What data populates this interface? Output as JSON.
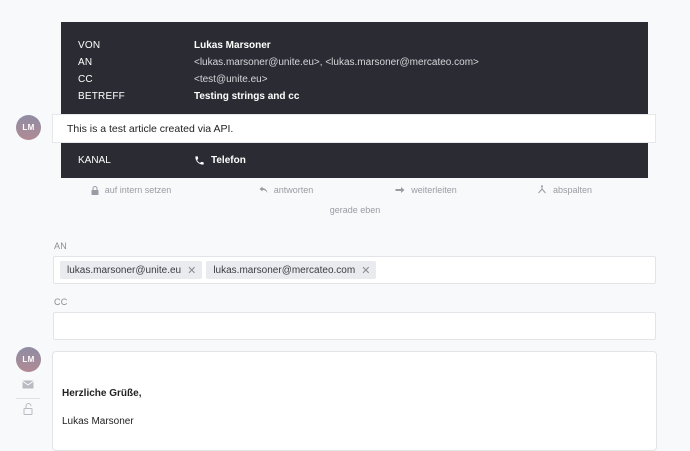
{
  "article": {
    "meta": [
      {
        "key": "VON",
        "value": "Lukas Marsoner",
        "strong": true
      },
      {
        "key": "AN",
        "value": "<lukas.marsoner@unite.eu>, <lukas.marsoner@mercateo.com>",
        "strong": false
      },
      {
        "key": "CC",
        "value": "<test@unite.eu>",
        "strong": false
      },
      {
        "key": "BETREFF",
        "value": "Testing strings and cc",
        "strong": true
      }
    ],
    "avatar_initials": "LM",
    "body": "This is a test article created via API.",
    "channel_key": "KANAL",
    "channel_value": "Telefon",
    "channel_icon": "phone-icon",
    "actions": [
      {
        "label": "auf intern setzen",
        "icon": "lock-icon"
      },
      {
        "label": "antworten",
        "icon": "reply-icon"
      },
      {
        "label": "weiterleiten",
        "icon": "forward-icon"
      },
      {
        "label": "abspalten",
        "icon": "split-icon"
      }
    ],
    "timestamp": "gerade eben"
  },
  "reply": {
    "to_label": "AN",
    "to_tokens": [
      "lukas.marsoner@unite.eu",
      "lukas.marsoner@mercateo.com"
    ],
    "remove_glyph": "✕",
    "cc_label": "CC",
    "cc_value": "",
    "avatar_initials": "LM",
    "side_icons": [
      "envelope-icon",
      "unlock-icon"
    ],
    "signature_greeting": "Herzliche Grüße,",
    "signature_name": "Lukas Marsoner"
  },
  "colors": {
    "meta_bg": "#2b2c33",
    "page_bg": "#f8f9fb",
    "muted_text": "#9a9ca3"
  }
}
